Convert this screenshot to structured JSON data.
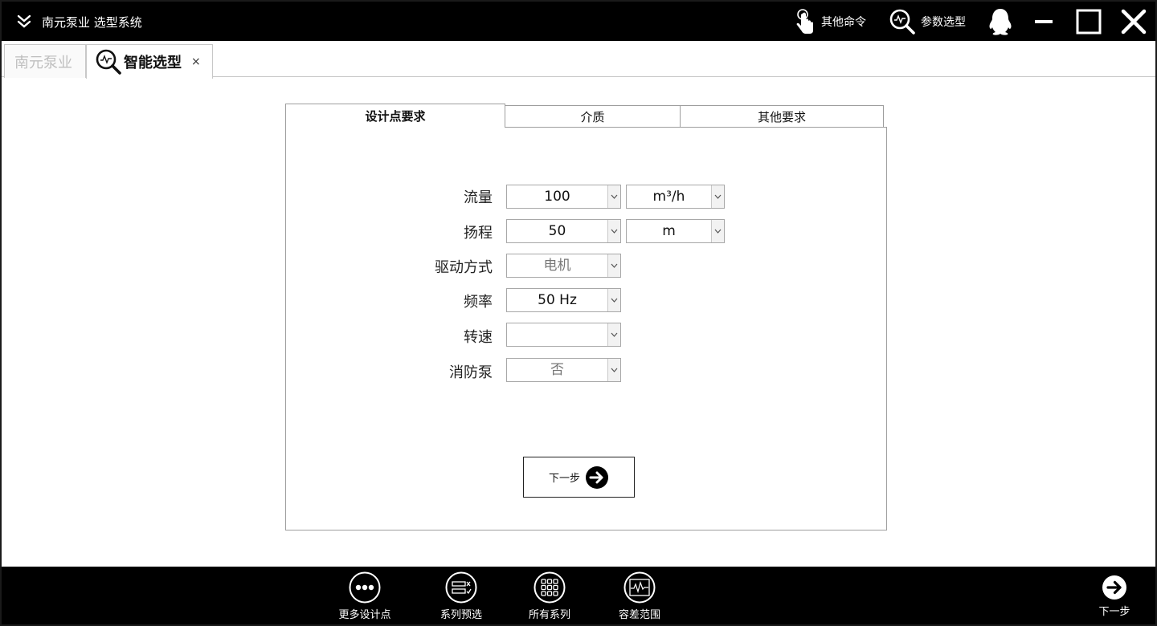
{
  "window": {
    "title": "南元泵业 选型系统",
    "commands": {
      "other": "其他命令",
      "param": "参数选型"
    }
  },
  "tabs": {
    "home": "南元泵业",
    "smart": "智能选型",
    "close": "×"
  },
  "panel_tabs": [
    "设计点要求",
    "介质",
    "其他要求"
  ],
  "form": {
    "flow": {
      "label": "流量",
      "value": "100",
      "unit": "m³/h"
    },
    "head": {
      "label": "扬程",
      "value": "50",
      "unit": "m"
    },
    "drive": {
      "label": "驱动方式",
      "value": "电机"
    },
    "frequency": {
      "label": "频率",
      "value": "50 Hz"
    },
    "speed": {
      "label": "转速",
      "value": ""
    },
    "fire_pump": {
      "label": "消防泵",
      "value": "否"
    }
  },
  "next_button": "下一步",
  "bottom": {
    "more_points": "更多设计点",
    "series_preselect": "系列预选",
    "all_series": "所有系列",
    "tolerance": "容差范围",
    "next": "下一步"
  }
}
